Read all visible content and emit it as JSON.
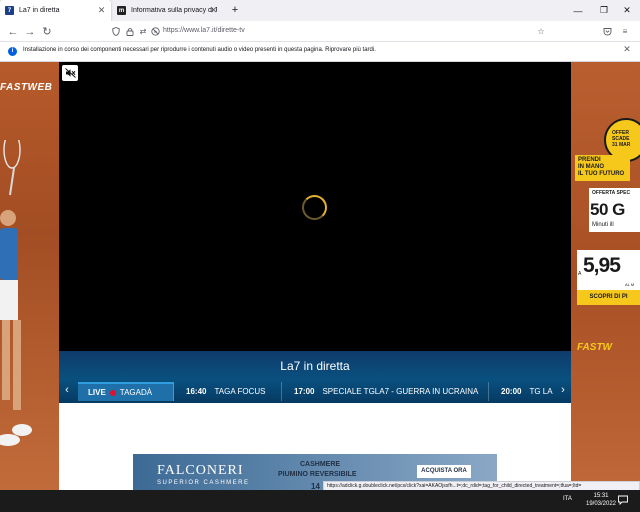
{
  "browser": {
    "tabs": [
      {
        "title": "La7 in diretta",
        "favicon": "7",
        "favicon_color": "#1b3f88",
        "active": true
      },
      {
        "title": "Informativa sulla privacy di Fire",
        "favicon": "m",
        "favicon_color": "#222222",
        "active": false
      }
    ],
    "new_tab_label": "+",
    "url": "https://www.la7.it/dirette-tv",
    "window_controls": {
      "minimize": "—",
      "maximize": "❐",
      "close": "✕"
    }
  },
  "notification": {
    "text": "Installazione in corso dei componenti necessari per riprodurre i contenuti audio o video presenti in questa pagina. Riprovare più tardi.",
    "icon": "info-icon"
  },
  "left_ad": {
    "brand": "FASTWEB"
  },
  "right_ad": {
    "offer_circle": [
      "OFFER",
      "SCADE",
      "31 MAR"
    ],
    "prendi_lines": [
      "PRENDI",
      "IN MANO",
      "IL TUO FUTURO"
    ],
    "offerta_label": "OFFERTA SPEC",
    "offerta_value": "50 G",
    "offerta_sub": "Minuti ill",
    "price_prefix": "A",
    "price_value": "5,95",
    "price_sub": "AL M",
    "cta": "SCOPRI DI PI",
    "brand": "FASTW"
  },
  "player": {
    "mute_icon": "speaker-muted-icon",
    "accent_color": "#e6b22e"
  },
  "guide": {
    "title": "La7 in diretta",
    "live_label": "LIVE",
    "slots": [
      {
        "time": "",
        "title": "TAGADÀ",
        "live": true
      },
      {
        "time": "16:40",
        "title": "TAGA FOCUS",
        "live": false
      },
      {
        "time": "17:00",
        "title": "SPECIALE TGLA7 - GUERRA IN UCRAINA",
        "live": false
      },
      {
        "time": "20:00",
        "title": "TG LA",
        "live": false
      }
    ]
  },
  "banner": {
    "brand": "FALCONERI",
    "brand_sub": "SUPERIOR CASHMERE",
    "headline_1": "CASHMERE",
    "headline_2": "PIUMINO REVERSIBILE",
    "headline_3": "14",
    "cta": "ACQUISTA ORA"
  },
  "status_link": "https://adclick.g.doubleclick.net/pcs/click?xai=AKAOjssfh...t=;dc_rdid=;tag_for_child_directed_treatment=;tfua=;ltd=",
  "taskbar": {
    "lang": "ITA",
    "time": "15:31",
    "date": "19/03/2022"
  }
}
